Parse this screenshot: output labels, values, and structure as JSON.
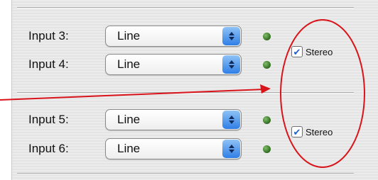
{
  "groups": [
    {
      "rows": [
        {
          "label": "Input 3:",
          "value": "Line"
        },
        {
          "label": "Input 4:",
          "value": "Line"
        }
      ],
      "stereo": {
        "label": "Stereo",
        "checked": true
      }
    },
    {
      "rows": [
        {
          "label": "Input 5:",
          "value": "Line"
        },
        {
          "label": "Input 6:",
          "value": "Line"
        }
      ],
      "stereo": {
        "label": "Stereo",
        "checked": true
      }
    }
  ],
  "icons": {
    "select_arrows": "up-down-arrows-icon",
    "status": "green-led-icon",
    "check": "checkmark-icon"
  },
  "colors": {
    "annotation": "#d8141a",
    "led": "#3a7a2a",
    "select_accent": "#3b82e6"
  }
}
